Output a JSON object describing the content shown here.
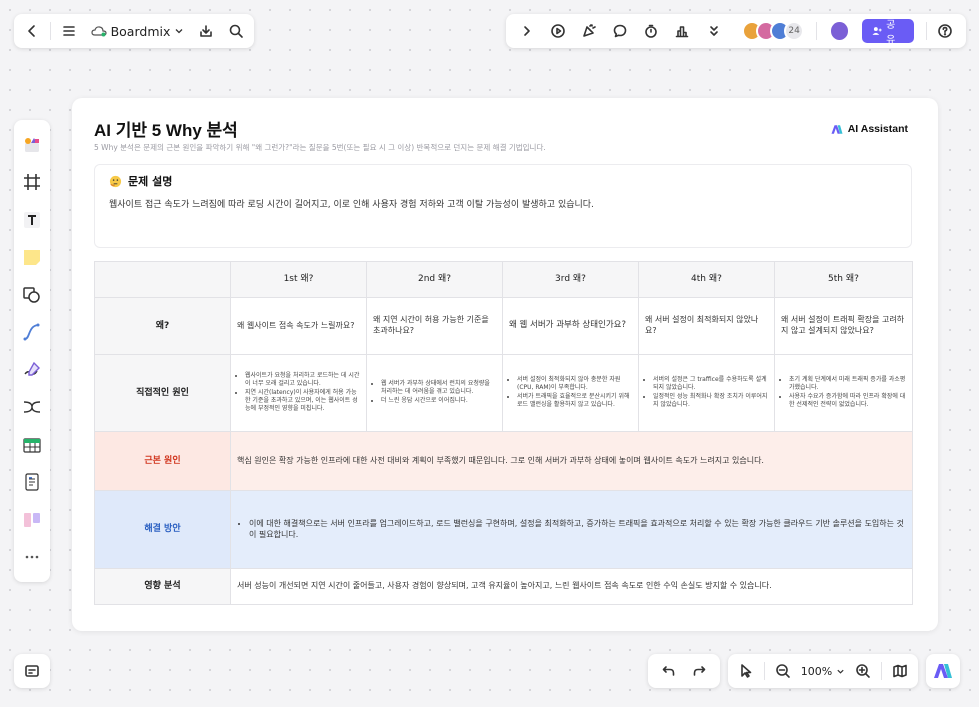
{
  "topbar": {
    "brand": "Boardmix",
    "avatar_count": "24",
    "share_label": "공유"
  },
  "zoom": {
    "value": "100%"
  },
  "card": {
    "title": "AI 기반 5 Why 분석",
    "subtitle": "5 Why 분석은 문제의 근본 원인을 파악하기 위해 \"왜 그런가?\"라는 질문을 5번(또는 필요 시 그 이상) 반복적으로 던지는 문제 해결 기법입니다.",
    "ai_assistant": "AI Assistant",
    "problem": {
      "title": "문제 설명",
      "text": "웹사이트 접근 속도가 느려짐에 따라 로딩 시간이 길어지고, 이로 인해 사용자 경험 저하와 고객 이탈 가능성이 발생하고 있습니다."
    },
    "table": {
      "headers": [
        "",
        "1st 왜?",
        "2nd 왜?",
        "3rd 왜?",
        "4th 왜?",
        "5th 왜?"
      ],
      "why_label": "왜?",
      "whys": [
        "왜 웹사이트 접속 속도가 느릴까요?",
        "왜 지연 시간이 허용 가능한 기준을 초과하나요?",
        "왜 웹 서버가 과부하 상태인가요?",
        "왜 서버 설정이 최적화되지 않았나요?",
        "왜 서버 설정이 트래픽 확장을 고려하지 않고 설계되지 않았나요?"
      ],
      "direct_label": "직접적인 원인",
      "direct": [
        [
          "웹사이트가 요청을 처리하고 로드하는 데 시간이 너무 오래 걸리고 있습니다.",
          "지연 시간(latency)이 사용자에게 허용 가능한 기준을 초과하고 있으며, 이는 웹사이트 성능에 부정적인 영향을 미칩니다."
        ],
        [
          "웹 서버가 과부하 상태에서 런치의 요청량을 처리하는 데 어려움을 겪고 있습니다.",
          "더 느린 응답 시간으로 이어집니다."
        ],
        [
          "서버 설정이 최적화되지 않아 충분한 자원(CPU, RAM)이 부족합니다.",
          "서버가 트래픽을 효율적으로 분산시키기 위해 로드 밸런싱을 활용하지 않고 있습니다."
        ],
        [
          "서버의 설정은 그 traffice를 수용하도록 설계되지 않았습니다.",
          "일정적인 성능 최적화나 확장 조치가 이루어지지 않았습니다."
        ],
        [
          "초기 계획 단계에서 미래 트래픽 증가를 과소평가했습니다.",
          "사용자 수요가 증가함에 따라 인프라 확장에 대한 선제적인 전략이 없었습니다."
        ]
      ],
      "root_label": "근본 원인",
      "root": "핵심 원인은 확장 가능한 인프라에 대한 사전 대비와 계획이 부족했기 때문입니다. 그로 인해 서버가 과부하 상태에 놓이며 웹사이트 속도가 느려지고 있습니다.",
      "solution_label": "해결 방안",
      "solution": "이에 대한 해결책으로는 서버 인프라를 업그레이드하고, 로드 밸런싱을 구현하며, 설정을 최적화하고, 증가하는 트래픽을 효과적으로 처리할 수 있는 확장 가능한 클라우드 기반 솔루션을 도입하는 것이 필요합니다.",
      "impact_label": "영향 분석",
      "impact": "서버 성능이 개선되면 지연 시간이 줄어들고, 사용자 경험이 향상되며, 고객 유지율이 높아지고, 느린 웹사이트 접속 속도로 인한 수익 손실도 방지할 수 있습니다."
    }
  },
  "colors": {
    "accent": "#6a5cf5",
    "root_bg": "#fdeeea",
    "root_text": "#d1361f",
    "solution_bg": "#e4edfb",
    "solution_text": "#2a5fc1"
  }
}
